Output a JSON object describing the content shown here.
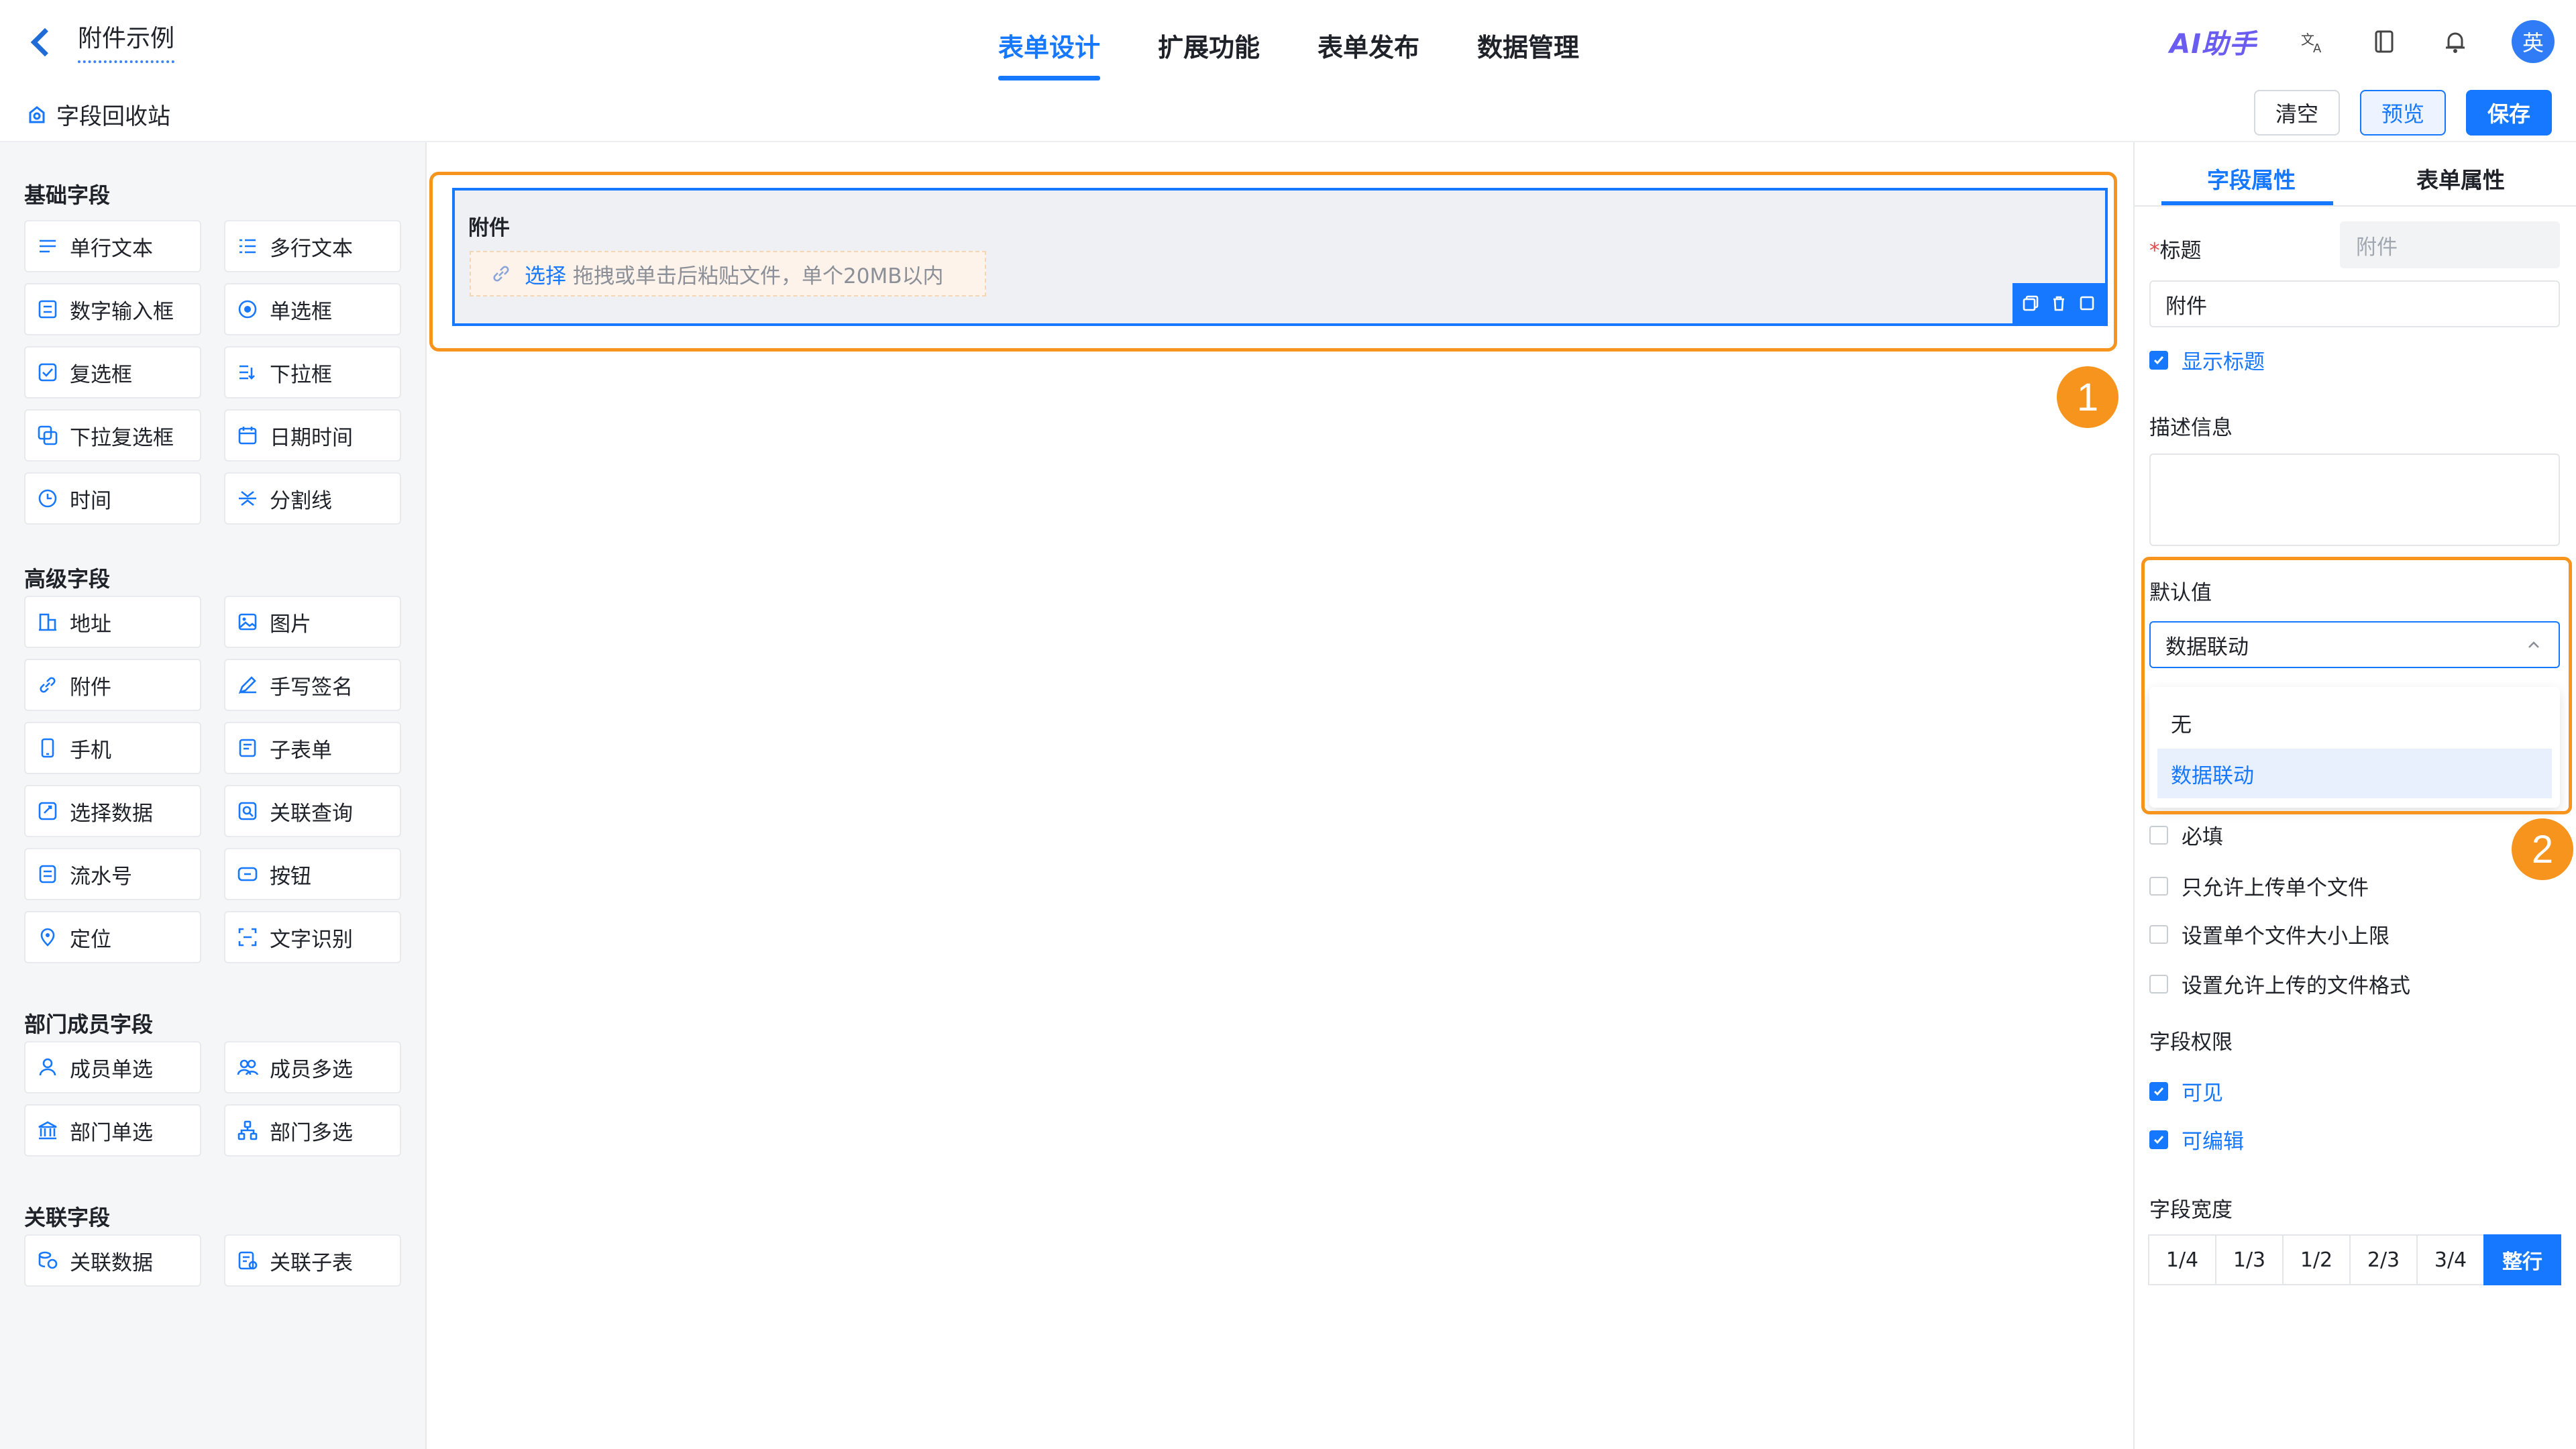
{
  "header": {
    "back_label": "附件示例",
    "tabs": [
      {
        "label": "表单设计"
      },
      {
        "label": "扩展功能"
      },
      {
        "label": "表单发布"
      },
      {
        "label": "数据管理"
      }
    ],
    "ai_label": "AI助手",
    "avatar_text": "英",
    "icons": [
      "translate-icon",
      "book-icon",
      "bell-icon"
    ]
  },
  "subbar": {
    "recycle_label": "字段回收站",
    "clear_label": "清空",
    "preview_label": "预览",
    "save_label": "保存"
  },
  "left": {
    "sections": [
      {
        "title": "基础字段",
        "items": [
          {
            "label": "单行文本",
            "icon": "single-line-icon"
          },
          {
            "label": "多行文本",
            "icon": "multi-line-icon"
          },
          {
            "label": "数字输入框",
            "icon": "number-icon"
          },
          {
            "label": "单选框",
            "icon": "radio-icon"
          },
          {
            "label": "复选框",
            "icon": "checkbox-icon"
          },
          {
            "label": "下拉框",
            "icon": "dropdown-icon"
          },
          {
            "label": "下拉复选框",
            "icon": "multi-dropdown-icon"
          },
          {
            "label": "日期时间",
            "icon": "calendar-icon"
          },
          {
            "label": "时间",
            "icon": "clock-icon"
          },
          {
            "label": "分割线",
            "icon": "divider-icon"
          }
        ]
      },
      {
        "title": "高级字段",
        "items": [
          {
            "label": "地址",
            "icon": "building-icon"
          },
          {
            "label": "图片",
            "icon": "image-icon"
          },
          {
            "label": "附件",
            "icon": "link-icon"
          },
          {
            "label": "手写签名",
            "icon": "pen-icon"
          },
          {
            "label": "手机",
            "icon": "phone-icon"
          },
          {
            "label": "子表单",
            "icon": "subform-icon"
          },
          {
            "label": "选择数据",
            "icon": "select-data-icon"
          },
          {
            "label": "关联查询",
            "icon": "search-link-icon"
          },
          {
            "label": "流水号",
            "icon": "serial-icon"
          },
          {
            "label": "按钮",
            "icon": "button-icon"
          },
          {
            "label": "定位",
            "icon": "location-icon"
          },
          {
            "label": "文字识别",
            "icon": "ocr-icon"
          }
        ]
      },
      {
        "title": "部门成员字段",
        "items": [
          {
            "label": "成员单选",
            "icon": "user-icon"
          },
          {
            "label": "成员多选",
            "icon": "users-icon"
          },
          {
            "label": "部门单选",
            "icon": "department-icon"
          },
          {
            "label": "部门多选",
            "icon": "org-icon"
          }
        ]
      },
      {
        "title": "关联字段",
        "items": [
          {
            "label": "关联数据",
            "icon": "link-data-icon"
          },
          {
            "label": "关联子表",
            "icon": "link-table-icon"
          }
        ]
      }
    ]
  },
  "canvas": {
    "field_label": "附件",
    "upload_choose": "选择",
    "upload_hint": "拖拽或单击后粘贴文件，单个20MB以内",
    "badge1": "1",
    "badge2": "2"
  },
  "right": {
    "tabs": [
      "字段属性",
      "表单属性"
    ],
    "title_label": "标题",
    "title_required_mark": "*",
    "title_placeholder": "附件",
    "title_value": "附件",
    "show_title": "显示标题",
    "desc_label": "描述信息",
    "default_label": "默认值",
    "default_value": "数据联动",
    "dropdown_options": [
      "无",
      "数据联动"
    ],
    "checks": [
      {
        "label": "必填",
        "checked": false
      },
      {
        "label": "只允许上传单个文件",
        "checked": false
      },
      {
        "label": "设置单个文件大小上限",
        "checked": false
      },
      {
        "label": "设置允许上传的文件格式",
        "checked": false
      }
    ],
    "perm_label": "字段权限",
    "perm_visible": "可见",
    "perm_editable": "可编辑",
    "width_label": "字段宽度",
    "widths": [
      "1/4",
      "1/3",
      "1/2",
      "2/3",
      "3/4",
      "整行"
    ],
    "width_selected": "整行"
  },
  "colors": {
    "accent": "#1677ff",
    "highlight": "#f7941d"
  }
}
